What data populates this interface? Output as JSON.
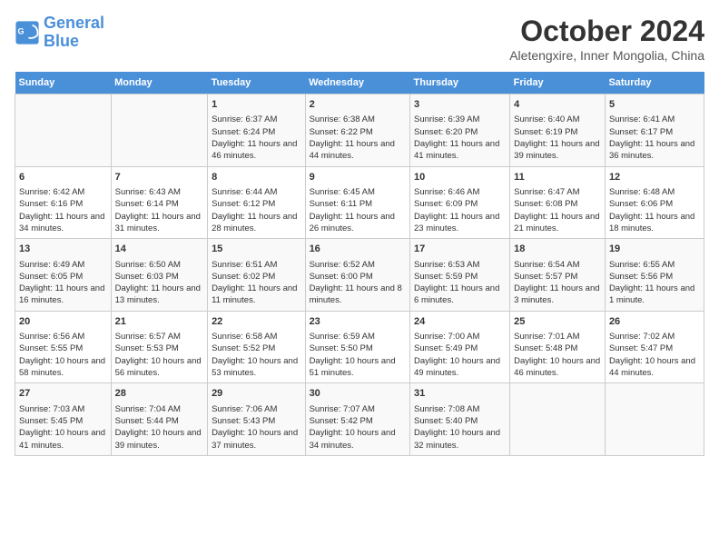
{
  "header": {
    "logo_line1": "General",
    "logo_line2": "Blue",
    "title": "October 2024",
    "subtitle": "Aletengxire, Inner Mongolia, China"
  },
  "days_of_week": [
    "Sunday",
    "Monday",
    "Tuesday",
    "Wednesday",
    "Thursday",
    "Friday",
    "Saturday"
  ],
  "weeks": [
    [
      {
        "day": "",
        "content": ""
      },
      {
        "day": "",
        "content": ""
      },
      {
        "day": "1",
        "content": "Sunrise: 6:37 AM\nSunset: 6:24 PM\nDaylight: 11 hours and 46 minutes."
      },
      {
        "day": "2",
        "content": "Sunrise: 6:38 AM\nSunset: 6:22 PM\nDaylight: 11 hours and 44 minutes."
      },
      {
        "day": "3",
        "content": "Sunrise: 6:39 AM\nSunset: 6:20 PM\nDaylight: 11 hours and 41 minutes."
      },
      {
        "day": "4",
        "content": "Sunrise: 6:40 AM\nSunset: 6:19 PM\nDaylight: 11 hours and 39 minutes."
      },
      {
        "day": "5",
        "content": "Sunrise: 6:41 AM\nSunset: 6:17 PM\nDaylight: 11 hours and 36 minutes."
      }
    ],
    [
      {
        "day": "6",
        "content": "Sunrise: 6:42 AM\nSunset: 6:16 PM\nDaylight: 11 hours and 34 minutes."
      },
      {
        "day": "7",
        "content": "Sunrise: 6:43 AM\nSunset: 6:14 PM\nDaylight: 11 hours and 31 minutes."
      },
      {
        "day": "8",
        "content": "Sunrise: 6:44 AM\nSunset: 6:12 PM\nDaylight: 11 hours and 28 minutes."
      },
      {
        "day": "9",
        "content": "Sunrise: 6:45 AM\nSunset: 6:11 PM\nDaylight: 11 hours and 26 minutes."
      },
      {
        "day": "10",
        "content": "Sunrise: 6:46 AM\nSunset: 6:09 PM\nDaylight: 11 hours and 23 minutes."
      },
      {
        "day": "11",
        "content": "Sunrise: 6:47 AM\nSunset: 6:08 PM\nDaylight: 11 hours and 21 minutes."
      },
      {
        "day": "12",
        "content": "Sunrise: 6:48 AM\nSunset: 6:06 PM\nDaylight: 11 hours and 18 minutes."
      }
    ],
    [
      {
        "day": "13",
        "content": "Sunrise: 6:49 AM\nSunset: 6:05 PM\nDaylight: 11 hours and 16 minutes."
      },
      {
        "day": "14",
        "content": "Sunrise: 6:50 AM\nSunset: 6:03 PM\nDaylight: 11 hours and 13 minutes."
      },
      {
        "day": "15",
        "content": "Sunrise: 6:51 AM\nSunset: 6:02 PM\nDaylight: 11 hours and 11 minutes."
      },
      {
        "day": "16",
        "content": "Sunrise: 6:52 AM\nSunset: 6:00 PM\nDaylight: 11 hours and 8 minutes."
      },
      {
        "day": "17",
        "content": "Sunrise: 6:53 AM\nSunset: 5:59 PM\nDaylight: 11 hours and 6 minutes."
      },
      {
        "day": "18",
        "content": "Sunrise: 6:54 AM\nSunset: 5:57 PM\nDaylight: 11 hours and 3 minutes."
      },
      {
        "day": "19",
        "content": "Sunrise: 6:55 AM\nSunset: 5:56 PM\nDaylight: 11 hours and 1 minute."
      }
    ],
    [
      {
        "day": "20",
        "content": "Sunrise: 6:56 AM\nSunset: 5:55 PM\nDaylight: 10 hours and 58 minutes."
      },
      {
        "day": "21",
        "content": "Sunrise: 6:57 AM\nSunset: 5:53 PM\nDaylight: 10 hours and 56 minutes."
      },
      {
        "day": "22",
        "content": "Sunrise: 6:58 AM\nSunset: 5:52 PM\nDaylight: 10 hours and 53 minutes."
      },
      {
        "day": "23",
        "content": "Sunrise: 6:59 AM\nSunset: 5:50 PM\nDaylight: 10 hours and 51 minutes."
      },
      {
        "day": "24",
        "content": "Sunrise: 7:00 AM\nSunset: 5:49 PM\nDaylight: 10 hours and 49 minutes."
      },
      {
        "day": "25",
        "content": "Sunrise: 7:01 AM\nSunset: 5:48 PM\nDaylight: 10 hours and 46 minutes."
      },
      {
        "day": "26",
        "content": "Sunrise: 7:02 AM\nSunset: 5:47 PM\nDaylight: 10 hours and 44 minutes."
      }
    ],
    [
      {
        "day": "27",
        "content": "Sunrise: 7:03 AM\nSunset: 5:45 PM\nDaylight: 10 hours and 41 minutes."
      },
      {
        "day": "28",
        "content": "Sunrise: 7:04 AM\nSunset: 5:44 PM\nDaylight: 10 hours and 39 minutes."
      },
      {
        "day": "29",
        "content": "Sunrise: 7:06 AM\nSunset: 5:43 PM\nDaylight: 10 hours and 37 minutes."
      },
      {
        "day": "30",
        "content": "Sunrise: 7:07 AM\nSunset: 5:42 PM\nDaylight: 10 hours and 34 minutes."
      },
      {
        "day": "31",
        "content": "Sunrise: 7:08 AM\nSunset: 5:40 PM\nDaylight: 10 hours and 32 minutes."
      },
      {
        "day": "",
        "content": ""
      },
      {
        "day": "",
        "content": ""
      }
    ]
  ]
}
